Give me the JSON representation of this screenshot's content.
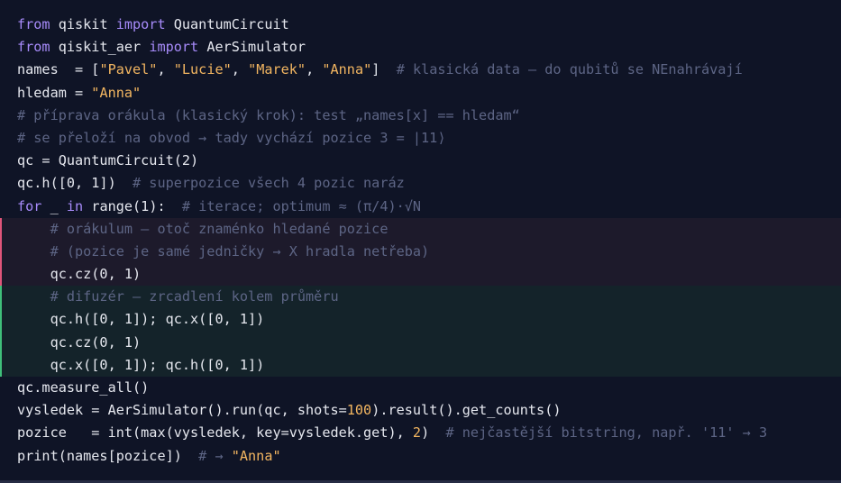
{
  "code": {
    "lines": [
      {
        "kind": "plain",
        "tokens": [
          {
            "t": "kw",
            "v": "from"
          },
          {
            "t": "id",
            "v": " qiskit "
          },
          {
            "t": "kw",
            "v": "import"
          },
          {
            "t": "id",
            "v": " QuantumCircuit"
          }
        ]
      },
      {
        "kind": "plain",
        "tokens": [
          {
            "t": "kw",
            "v": "from"
          },
          {
            "t": "id",
            "v": " qiskit_aer "
          },
          {
            "t": "kw",
            "v": "import"
          },
          {
            "t": "id",
            "v": " AerSimulator"
          }
        ]
      },
      {
        "kind": "plain",
        "tokens": [
          {
            "t": "id",
            "v": "names  = ["
          },
          {
            "t": "str",
            "v": "\"Pavel\""
          },
          {
            "t": "id",
            "v": ", "
          },
          {
            "t": "str",
            "v": "\"Lucie\""
          },
          {
            "t": "id",
            "v": ", "
          },
          {
            "t": "str",
            "v": "\"Marek\""
          },
          {
            "t": "id",
            "v": ", "
          },
          {
            "t": "str",
            "v": "\"Anna\""
          },
          {
            "t": "id",
            "v": "]  "
          },
          {
            "t": "cm",
            "v": "# klasická data — do qubitů se NEnahrávají"
          }
        ]
      },
      {
        "kind": "plain",
        "tokens": [
          {
            "t": "id",
            "v": "hledam = "
          },
          {
            "t": "str",
            "v": "\"Anna\""
          }
        ]
      },
      {
        "kind": "plain",
        "tokens": [
          {
            "t": "cm",
            "v": "# příprava orákula (klasický krok): test „names[x] == hledam“"
          }
        ]
      },
      {
        "kind": "plain",
        "tokens": [
          {
            "t": "cm",
            "v": "# se přeloží na obvod → tady vychází pozice 3 = |11⟩"
          }
        ]
      },
      {
        "kind": "plain",
        "tokens": [
          {
            "t": "id",
            "v": "qc = QuantumCircuit(2)"
          }
        ]
      },
      {
        "kind": "plain",
        "tokens": [
          {
            "t": "id",
            "v": "qc.h([0, 1])  "
          },
          {
            "t": "cm",
            "v": "# superpozice všech 4 pozic naráz"
          }
        ]
      },
      {
        "kind": "plain",
        "tokens": [
          {
            "t": "kw",
            "v": "for"
          },
          {
            "t": "id",
            "v": " _ "
          },
          {
            "t": "kw",
            "v": "in"
          },
          {
            "t": "id",
            "v": " range(1):  "
          },
          {
            "t": "cm",
            "v": "# iterace; optimum ≈ (π/4)·√N"
          }
        ]
      },
      {
        "kind": "oracle",
        "tokens": [
          {
            "t": "cm",
            "v": "    # orákulum — otoč znaménko hledané pozice"
          }
        ]
      },
      {
        "kind": "oracle",
        "tokens": [
          {
            "t": "cm",
            "v": "    # (pozice je samé jedničky → X hradla netřeba)"
          }
        ]
      },
      {
        "kind": "oracle",
        "tokens": [
          {
            "t": "id",
            "v": "    qc.cz(0, 1)"
          }
        ]
      },
      {
        "kind": "diffuser",
        "tokens": [
          {
            "t": "cm",
            "v": "    # difuzér — zrcadlení kolem průměru"
          }
        ]
      },
      {
        "kind": "diffuser",
        "tokens": [
          {
            "t": "id",
            "v": "    qc.h([0, 1]); qc.x([0, 1])"
          }
        ]
      },
      {
        "kind": "diffuser",
        "tokens": [
          {
            "t": "id",
            "v": "    qc.cz(0, 1)"
          }
        ]
      },
      {
        "kind": "diffuser",
        "tokens": [
          {
            "t": "id",
            "v": "    qc.x([0, 1]); qc.h([0, 1])"
          }
        ]
      },
      {
        "kind": "plain",
        "tokens": [
          {
            "t": "id",
            "v": "qc.measure_all()"
          }
        ]
      },
      {
        "kind": "plain",
        "tokens": [
          {
            "t": "id",
            "v": "vysledek = AerSimulator().run(qc, shots="
          },
          {
            "t": "num",
            "v": "100"
          },
          {
            "t": "id",
            "v": ").result().get_counts()"
          }
        ]
      },
      {
        "kind": "plain",
        "tokens": [
          {
            "t": "id",
            "v": "pozice   = int(max(vysledek, key=vysledek.get), "
          },
          {
            "t": "num",
            "v": "2"
          },
          {
            "t": "id",
            "v": ")  "
          },
          {
            "t": "cm",
            "v": "# nejčastější bitstring, např. '11' → 3"
          }
        ]
      },
      {
        "kind": "plain",
        "tokens": [
          {
            "t": "id",
            "v": "print(names[pozice])  "
          },
          {
            "t": "cm",
            "v": "# → "
          },
          {
            "t": "str",
            "v": "\"Anna\""
          }
        ]
      }
    ]
  },
  "colors": {
    "background": "#0f1426",
    "keyword": "#a78bfa",
    "string": "#f3b661",
    "comment": "#5d6585",
    "text": "#e6e8ef",
    "oracle_accent": "#e0557a",
    "diffuser_accent": "#3fbf7a"
  }
}
